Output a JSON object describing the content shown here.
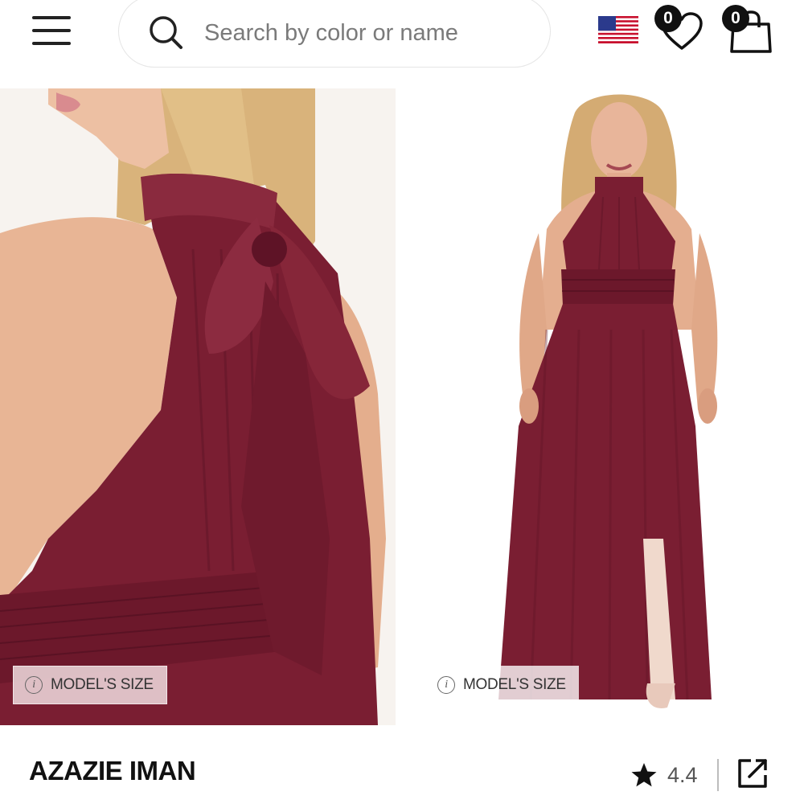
{
  "header": {
    "menu_icon": "hamburger-menu-icon",
    "search": {
      "placeholder": "Search by color or name",
      "value": ""
    },
    "region_icon": "us-flag-icon",
    "wishlist": {
      "count": "0",
      "icon": "heart-icon"
    },
    "cart": {
      "count": "0",
      "icon": "shopping-bag-icon"
    }
  },
  "gallery": {
    "images": [
      {
        "view": "back-detail",
        "model_size_label": "MODEL'S SIZE"
      },
      {
        "view": "front-full",
        "model_size_label": "MODEL'S SIZE"
      }
    ],
    "info_icon_glyph": "i"
  },
  "product": {
    "name": "AZAZIE IMAN",
    "rating": "4.4",
    "rating_icon": "star-icon",
    "share_icon": "share-external-icon"
  },
  "colors": {
    "dress": "#7a1e32",
    "dress_shadow": "#5e1326",
    "skin": "#e9b597",
    "hair": "#d8b27a",
    "badge": "#111111"
  }
}
